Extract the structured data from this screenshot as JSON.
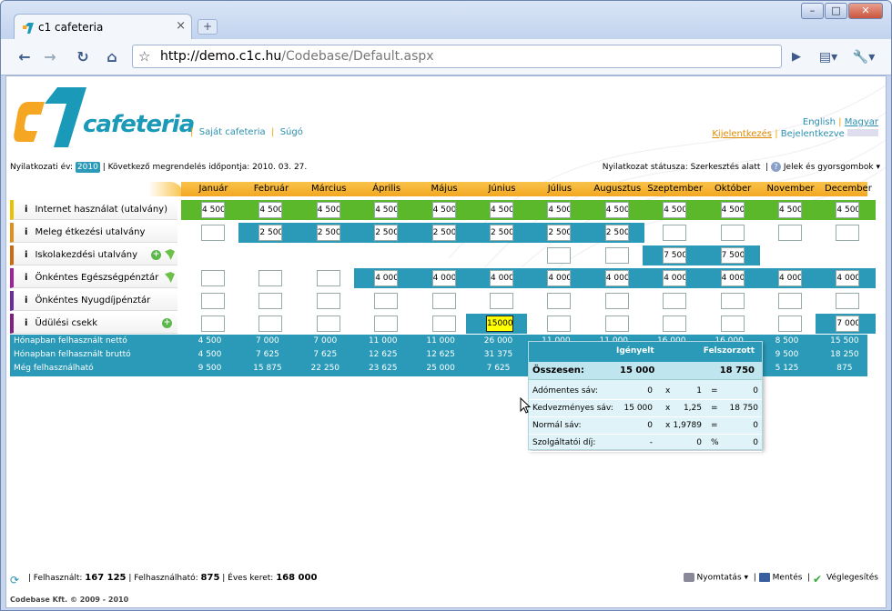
{
  "browser": {
    "tab_title": "c1 cafeteria",
    "tab_close": "×",
    "new_tab": "+",
    "url_host": "http://demo.c1c.hu",
    "url_path": "/Codebase/Default.aspx",
    "min": "–",
    "max": "□",
    "close": "✕"
  },
  "header": {
    "logo_text": "cafeteria",
    "links": [
      "Saját cafeteria",
      "Súgó"
    ],
    "lang_en": "English",
    "lang_hu": "Magyar",
    "logout": "Kijelentkezés",
    "logged_in": "Bejelentkezve"
  },
  "infobar": {
    "year_label": "Nyilatkozati év:",
    "year": "2010",
    "next_order": "| Következő megrendelés időpontja: 2010. 03. 27.",
    "status": "Nyilatkozat státusza: Szerkesztés alatt",
    "legend_link": "Jelek és gyorsgombok ▾"
  },
  "months": [
    "Január",
    "Február",
    "Március",
    "Április",
    "Május",
    "Június",
    "Július",
    "Augusztus",
    "Szeptember",
    "Október",
    "November",
    "December"
  ],
  "rows": [
    {
      "label": "Internet használat (utalvány)",
      "accent": "#e8c400",
      "values": [
        "4 500",
        "4 500",
        "4 500",
        "4 500",
        "4 500",
        "4 500",
        "4 500",
        "4 500",
        "4 500",
        "4 500",
        "4 500",
        "4 500"
      ]
    },
    {
      "label": "Meleg étkezési utalvány",
      "accent": "#e0901a",
      "values": [
        "",
        "2 500",
        "2 500",
        "2 500",
        "2 500",
        "2 500",
        "2 500",
        "2 500",
        "",
        "",
        "",
        ""
      ]
    },
    {
      "label": "Iskolakezdési utalvány",
      "accent": "#d06a10",
      "values": [
        "",
        "",
        "",
        "",
        "",
        "",
        "",
        "",
        "7 500",
        "7 500",
        "",
        ""
      ]
    },
    {
      "label": "Önkéntes Egészségpénztár",
      "accent": "#a020a0",
      "values": [
        "",
        "",
        "",
        "4 000",
        "4 000",
        "4 000",
        "4 000",
        "4 000",
        "4 000",
        "4 000",
        "4 000",
        "4 000"
      ]
    },
    {
      "label": "Önkéntes Nyugdíjpénztár",
      "accent": "#6a2aa0",
      "values": [
        "",
        "",
        "",
        "",
        "",
        "",
        "",
        "",
        "",
        "",
        "",
        ""
      ]
    },
    {
      "label": "Üdülési csekk",
      "accent": "#802080",
      "values": [
        "",
        "",
        "",
        "",
        "",
        "15000",
        "",
        "",
        "",
        "",
        "",
        "7 000"
      ]
    }
  ],
  "info_letter": "i",
  "summary": {
    "rows": [
      {
        "label": "Hónapban felhasznált nettó",
        "values": [
          "4 500",
          "7 000",
          "7 000",
          "11 000",
          "11 000",
          "26 000",
          "11 000",
          "11 000",
          "16 000",
          "16 000",
          "8 500",
          "15 500"
        ]
      },
      {
        "label": "Hónapban felhasznált bruttó",
        "values": [
          "4 500",
          "7 625",
          "7 625",
          "12 625",
          "12 625",
          "31 375",
          "",
          "",
          "",
          "",
          "9 500",
          "18 250"
        ]
      },
      {
        "label": "Még felhasználható",
        "values": [
          "9 500",
          "15 875",
          "22 250",
          "23 625",
          "25 000",
          "7 625",
          "",
          "",
          "",
          "",
          "5 125",
          "875"
        ]
      }
    ]
  },
  "popup": {
    "col1": "Igényelt",
    "col2": "Felszorzott",
    "total_label": "Összesen:",
    "total_req": "15 000",
    "total_mult": "18 750",
    "lines": [
      {
        "label": "Adómentes sáv:",
        "a": "0",
        "op": "x",
        "b": "1",
        "eq": "=",
        "c": "0"
      },
      {
        "label": "Kedvezményes sáv:",
        "a": "15 000",
        "op": "x",
        "b": "1,25",
        "eq": "=",
        "c": "18 750"
      },
      {
        "label": "Normál sáv:",
        "a": "0",
        "op": "x",
        "b": "1,9789",
        "eq": "=",
        "c": "0"
      },
      {
        "label": "Szolgáltatói díj:",
        "a": "-",
        "op": "",
        "b": "0",
        "eq": "%",
        "c": "0"
      }
    ]
  },
  "footer": {
    "used_label": "| Felhasznált:",
    "used": "167 125",
    "avail_label": "| Felhasználható:",
    "avail": "875",
    "annual_label": "| Éves keret:",
    "annual": "168 000",
    "print": "Nyomtatás ▾",
    "save": "Mentés",
    "finalize": "Véglegesítés",
    "copyright": "Codebase Kft. © 2009 - 2010"
  }
}
